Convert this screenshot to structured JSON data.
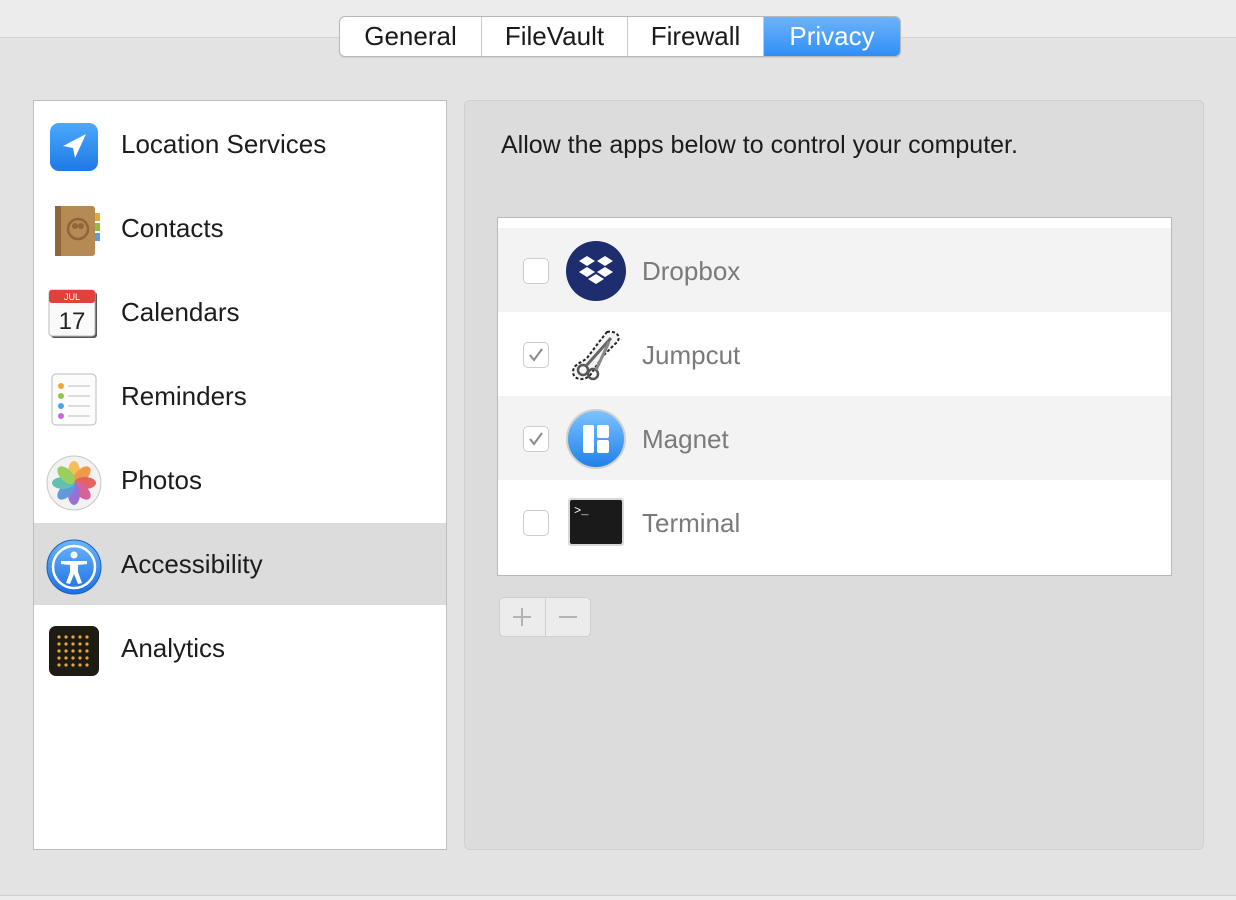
{
  "tabs": [
    {
      "label": "General",
      "selected": false
    },
    {
      "label": "FileVault",
      "selected": false
    },
    {
      "label": "Firewall",
      "selected": false
    },
    {
      "label": "Privacy",
      "selected": true
    }
  ],
  "sidebar": {
    "items": [
      {
        "label": "Location Services",
        "icon": "location-arrow-icon",
        "selected": false
      },
      {
        "label": "Contacts",
        "icon": "contacts-book-icon",
        "selected": false
      },
      {
        "label": "Calendars",
        "icon": "calendar-icon",
        "selected": false,
        "icon_text": {
          "month": "JUL",
          "day": "17"
        }
      },
      {
        "label": "Reminders",
        "icon": "reminders-list-icon",
        "selected": false
      },
      {
        "label": "Photos",
        "icon": "photos-flower-icon",
        "selected": false
      },
      {
        "label": "Accessibility",
        "icon": "accessibility-person-icon",
        "selected": true
      },
      {
        "label": "Analytics",
        "icon": "analytics-grid-icon",
        "selected": false
      }
    ]
  },
  "main": {
    "description": "Allow the apps below to control your computer.",
    "apps": [
      {
        "name": "Dropbox",
        "checked": false,
        "icon": "dropbox-icon"
      },
      {
        "name": "Jumpcut",
        "checked": true,
        "icon": "scissors-icon"
      },
      {
        "name": "Magnet",
        "checked": true,
        "icon": "magnet-icon"
      },
      {
        "name": "Terminal",
        "checked": false,
        "icon": "terminal-icon",
        "icon_text": ">_"
      }
    ],
    "add_button": "plus-icon",
    "remove_button": "minus-icon"
  },
  "colors": {
    "accent": "#3d95f7",
    "window_bg": "#e3e3e3",
    "panel_bg": "#dcdcdc",
    "selected_row": "#dcdcdc"
  }
}
